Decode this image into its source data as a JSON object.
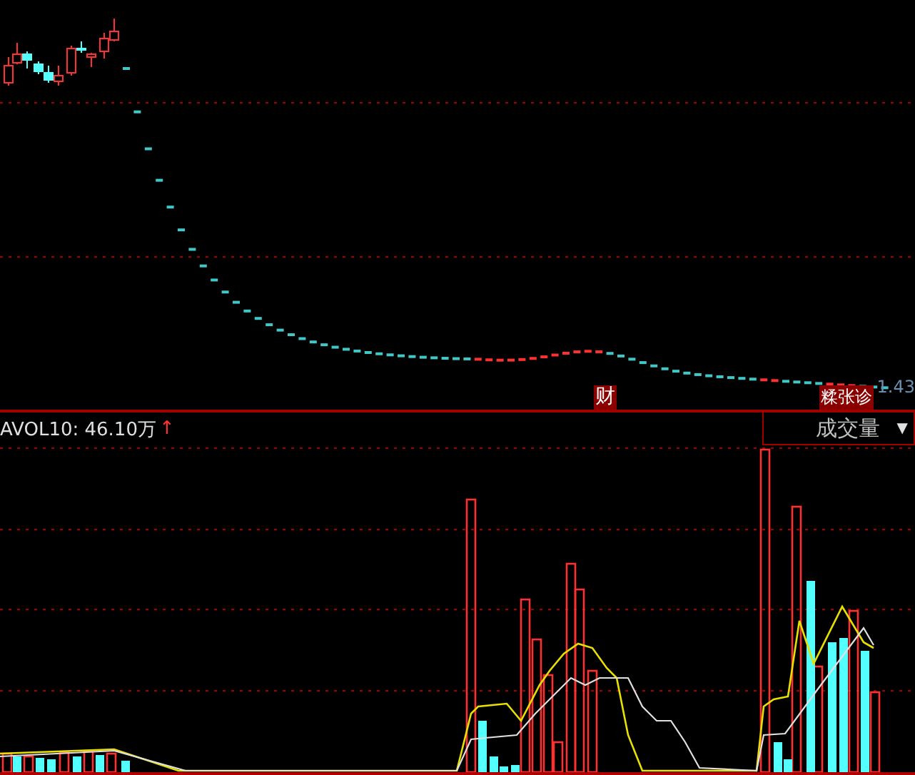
{
  "price_chart": {
    "markers": [
      {
        "label": "财",
        "kind": "finance"
      },
      {
        "label": "糅张诊",
        "kind": "diagnosis"
      }
    ],
    "price_label": "1.43"
  },
  "volume_panel": {
    "indicator": "AVOL10: 46.10万",
    "trend_arrow": "↑",
    "selector": {
      "label": "成交量",
      "caret": "▼"
    }
  }
}
